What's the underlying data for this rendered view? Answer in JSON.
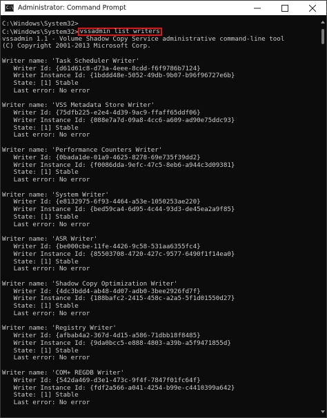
{
  "window": {
    "title": "Administrator: Command Prompt",
    "icon": "cmd-icon",
    "icon_text": "C:\\"
  },
  "controls": {
    "minimize": "minimize-icon",
    "maximize": "maximize-icon",
    "close": "close-icon"
  },
  "console": {
    "prompt1": "C:\\Windows\\System32>",
    "prompt2": "C:\\Windows\\System32>",
    "command": "vssadmin list writers",
    "header_lines": [
      "vssadmin 1.1 - Volume Shadow Copy Service administrative command-line tool",
      "(C) Copyright 2001-2013 Microsoft Corp."
    ],
    "writers": [
      {
        "name": "Writer name: 'Task Scheduler Writer'",
        "id": "   Writer Id: {d61d61c8-d73a-4eee-8cdd-f6f9786b7124}",
        "instance": "   Writer Instance Id: {1bddd48e-5052-49db-9b07-b96f96727e6b}",
        "state": "   State: [1] Stable",
        "error": "   Last error: No error"
      },
      {
        "name": "Writer name: 'VSS Metadata Store Writer'",
        "id": "   Writer Id: {75dfb225-e2e4-4d39-9ac9-ffaff65ddf06}",
        "instance": "   Writer Instance Id: {088e7a7d-09a8-4cc6-a609-ad90e75ddc93}",
        "state": "   State: [1] Stable",
        "error": "   Last error: No error"
      },
      {
        "name": "Writer name: 'Performance Counters Writer'",
        "id": "   Writer Id: {0bada1de-01a9-4625-8278-69e735f39dd2}",
        "instance": "   Writer Instance Id: {f0086dda-9efc-47c5-8eb6-a944c3d09381}",
        "state": "   State: [1] Stable",
        "error": "   Last error: No error"
      },
      {
        "name": "Writer name: 'System Writer'",
        "id": "   Writer Id: {e8132975-6f93-4464-a53e-1050253ae220}",
        "instance": "   Writer Instance Id: {bed59ca4-6d95-4c44-93d3-de45ea2a9f85}",
        "state": "   State: [1] Stable",
        "error": "   Last error: No error"
      },
      {
        "name": "Writer name: 'ASR Writer'",
        "id": "   Writer Id: {be000cbe-11fe-4426-9c58-531aa6355fc4}",
        "instance": "   Writer Instance Id: {85503708-4720-427c-9577-6490f1f14ea0}",
        "state": "   State: [1] Stable",
        "error": "   Last error: No error"
      },
      {
        "name": "Writer name: 'Shadow Copy Optimization Writer'",
        "id": "   Writer Id: {4dc3bdd4-ab48-4d07-adb0-3bee2926fd7f}",
        "instance": "   Writer Instance Id: {188bafc2-2415-458c-a2a5-5f1d01550d27}",
        "state": "   State: [1] Stable",
        "error": "   Last error: No error"
      },
      {
        "name": "Writer name: 'Registry Writer'",
        "id": "   Writer Id: {afbab4a2-367d-4d15-a586-71dbb18f8485}",
        "instance": "   Writer Instance Id: {9da0bcc5-e888-4803-a39b-a5f9471855d}",
        "state": "   State: [1] Stable",
        "error": "   Last error: No error"
      },
      {
        "name": "Writer name: 'COM+ REGDB Writer'",
        "id": "   Writer Id: {542da469-d3e1-473c-9f4f-7847f01fc64f}",
        "instance": "   Writer Instance Id: {fdf2a566-a041-4254-b99e-c4410399a642}",
        "state": "   State: [1] Stable",
        "error": "   Last error: No error"
      }
    ]
  },
  "colors": {
    "console_bg": "#0c0c0c",
    "console_text": "#cccccc",
    "highlight_border": "#e51212",
    "titlebar_bg": "#ffffff"
  }
}
